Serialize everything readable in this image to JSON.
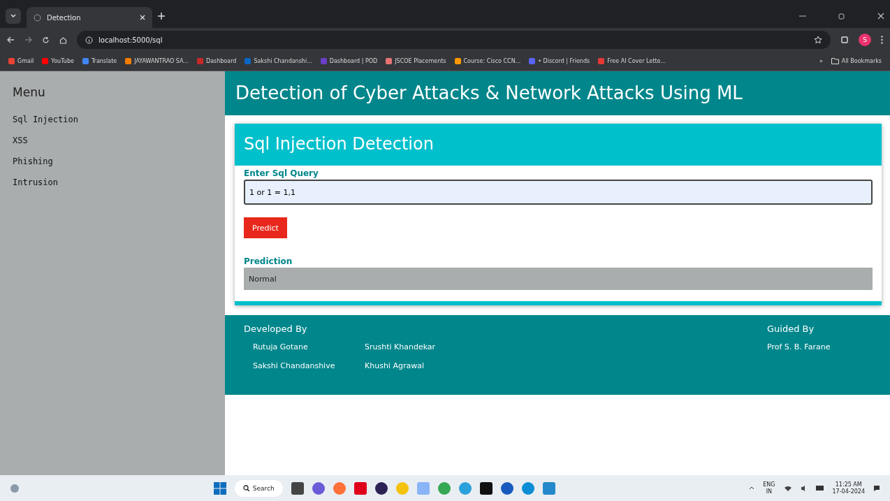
{
  "browser": {
    "tab": {
      "title": "Detection",
      "selected": true
    },
    "url": "localhost:5000/sql",
    "profile_initial": "S",
    "bookmarks": [
      {
        "label": "Gmail",
        "color": "#ea4335"
      },
      {
        "label": "YouTube",
        "color": "#ff0000"
      },
      {
        "label": "Translate",
        "color": "#4285f4"
      },
      {
        "label": "JAYAWANTRAO SA...",
        "color": "#f57c00"
      },
      {
        "label": "Dashboard",
        "color": "#c62828"
      },
      {
        "label": "Sakshi Chandanshi...",
        "color": "#0a66c2"
      },
      {
        "label": "Dashboard | POD",
        "color": "#6a3fc9"
      },
      {
        "label": "JSCOE Placements",
        "color": "#e57373"
      },
      {
        "label": "Course: Cisco CCN...",
        "color": "#ff9800"
      },
      {
        "label": "• Discord | Friends",
        "color": "#5865f2"
      },
      {
        "label": "Free AI Cover Lette...",
        "color": "#e53935"
      }
    ],
    "more": "»",
    "all_bookmarks": "All Bookmarks"
  },
  "sidebar": {
    "title": "Menu",
    "items": [
      {
        "label": "Sql Injection"
      },
      {
        "label": "XSS"
      },
      {
        "label": "Phishing"
      },
      {
        "label": "Intrusion"
      }
    ]
  },
  "header": {
    "title": "Detection of Cyber Attacks & Network Attacks Using ML"
  },
  "card": {
    "title": "Sql Injection Detection",
    "query_label": "Enter Sql Query",
    "query_value": "1 or 1 = 1,1",
    "button": "Predict",
    "prediction_label": "Prediction",
    "prediction_value": "Normal"
  },
  "footer": {
    "developed_title": "Developed By",
    "developers": [
      "Rutuja Gotane",
      "Srushti Khandekar",
      "Sakshi Chandanshive",
      "Khushi Agrawal"
    ],
    "guided_title": "Guided By",
    "guide": "Prof S. B. Farane"
  },
  "taskbar": {
    "search": "Search",
    "apps": [
      {
        "color": "#444444"
      },
      {
        "color": "#6b5bd6"
      },
      {
        "color": "#ff7139"
      },
      {
        "color": "#e0001b"
      },
      {
        "color": "#2c2255"
      },
      {
        "color": "#f4c20d"
      },
      {
        "color": "#8ab4f8"
      },
      {
        "color": "#34a853"
      },
      {
        "color": "#2aa1da"
      },
      {
        "color": "#111111"
      },
      {
        "color": "#185abd"
      },
      {
        "color": "#0c8dd6"
      },
      {
        "color": "#2489ca"
      }
    ],
    "language": "ENG",
    "region": "IN",
    "time": "11:25 AM",
    "date": "17-04-2024"
  }
}
